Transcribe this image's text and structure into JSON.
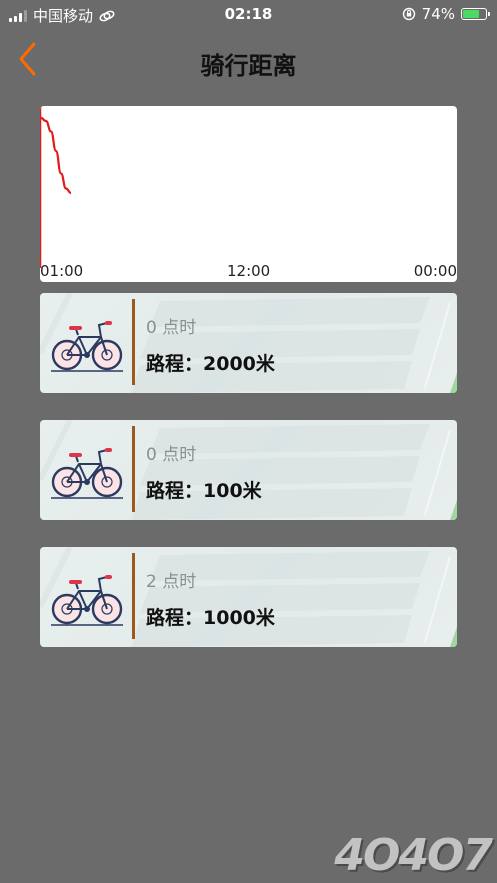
{
  "status_bar": {
    "carrier": "中国移动",
    "time": "02:18",
    "battery_percent": "74%",
    "battery_level": 0.74
  },
  "header": {
    "title": "骑行距离"
  },
  "chart_data": {
    "type": "line",
    "x_ticks": [
      "01:00",
      "12:00",
      "00:00"
    ],
    "series": [
      {
        "values": [
          0.92,
          0.9,
          0.83,
          0.7,
          0.55,
          0.45,
          0.42
        ]
      }
    ],
    "line_color": "#e31a1a"
  },
  "records": [
    {
      "hour_label": "0 点时",
      "distance_label": "路程：2000米"
    },
    {
      "hour_label": "0 点时",
      "distance_label": "路程：100米"
    },
    {
      "hour_label": "2 点时",
      "distance_label": "路程：1000米"
    }
  ],
  "watermark": "4O4O7",
  "colors": {
    "accent": "#ff6a00",
    "divider": "#9a5a1e",
    "background": "#6b6b6b"
  }
}
